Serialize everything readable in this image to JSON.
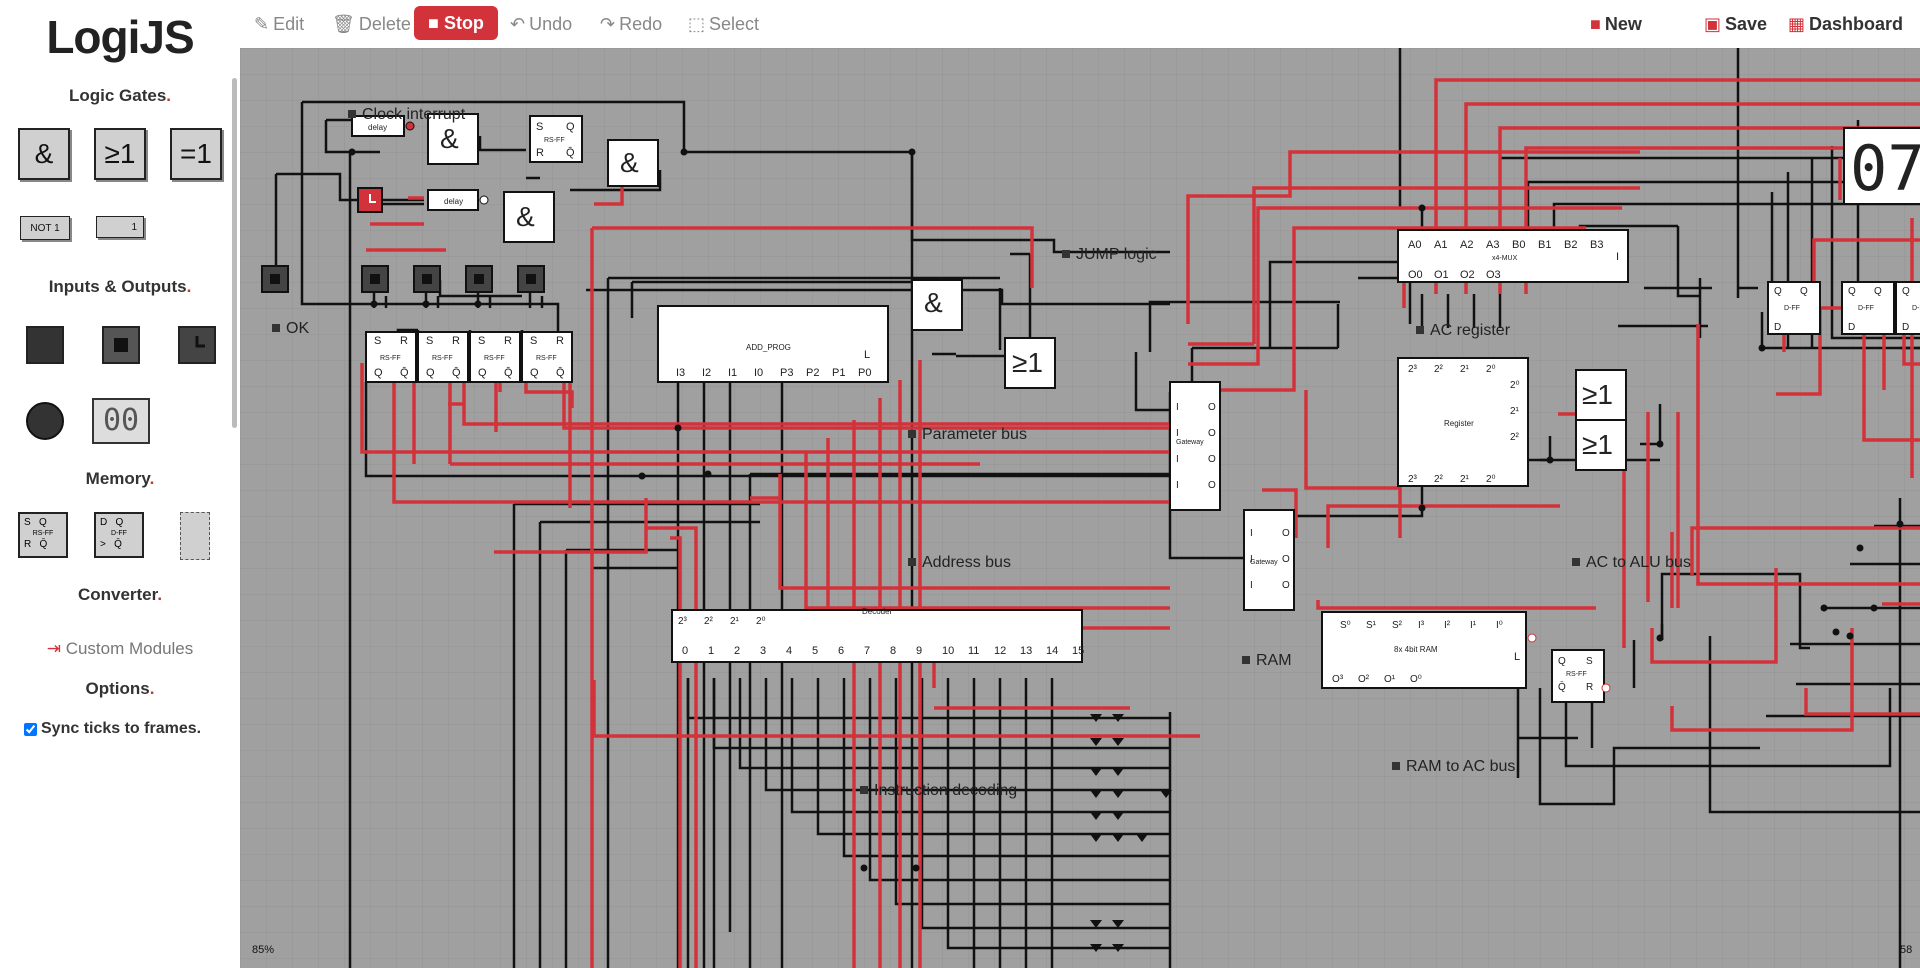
{
  "app": {
    "title": "LogiJS"
  },
  "sidebar": {
    "sections": {
      "logic_gates": "Logic Gates",
      "inputs_outputs": "Inputs & Outputs",
      "memory": "Memory",
      "converter": "Converter",
      "custom_modules": "Custom Modules",
      "options": "Options"
    },
    "gates": [
      {
        "label": "&"
      },
      {
        "label": "≥1"
      },
      {
        "label": "=1"
      }
    ],
    "unary": [
      {
        "label": "NOT 1"
      },
      {
        "label": "1"
      }
    ],
    "io_display": "00",
    "memory": [
      {
        "top": "S   Q",
        "mid": "RS-FF",
        "bot": "R   Q̄"
      },
      {
        "top": "D   Q",
        "mid": "D-FF",
        "bot": ">   Q̄"
      }
    ],
    "sync_ticks": {
      "label": "Sync ticks to frames.",
      "checked": true
    }
  },
  "toolbar": {
    "edit": "Edit",
    "delete": "Delete",
    "stop": "Stop",
    "undo": "Undo",
    "redo": "Redo",
    "select": "Select",
    "new": "New",
    "save": "Save",
    "dashboard": "Dashboard"
  },
  "canvas": {
    "labels": {
      "clock_interrupt": "Clock interrupt",
      "ok": "OK",
      "jump_logic": "JUMP logic",
      "parameter_bus": "Parameter bus",
      "address_bus": "Address bus",
      "instruction_decoding": "Instruction decoding",
      "ram": "RAM",
      "ac_register": "AC register",
      "ac_to_alu_bus": "AC to ALU bus",
      "ram_to_ac_bus": "RAM to AC bus"
    },
    "gates": {
      "and": "&",
      "or": "≥1",
      "delay": "delay"
    },
    "components": {
      "add_prog": {
        "name": "ADD_PROG",
        "pins": [
          "I3",
          "I2",
          "I1",
          "I0",
          "P3",
          "P2",
          "P1",
          "P0"
        ],
        "load": "L"
      },
      "decoder": {
        "name": "Decoder",
        "inputs": [
          "2³",
          "2²",
          "2¹",
          "2⁰"
        ],
        "outputs": [
          "0",
          "1",
          "2",
          "3",
          "4",
          "5",
          "6",
          "7",
          "8",
          "9",
          "10",
          "11",
          "12",
          "13",
          "14",
          "15"
        ]
      },
      "mux": {
        "name": "x4-MUX",
        "inputs": [
          "A0",
          "A1",
          "A2",
          "A3",
          "B0",
          "B1",
          "B2",
          "B3"
        ],
        "outputs": [
          "O0",
          "O1",
          "O2",
          "O3"
        ],
        "sel": "I"
      },
      "register": {
        "name": "Register",
        "pins_top": [
          "2³",
          "2²",
          "2¹",
          "2⁰"
        ],
        "pins_right": [
          "2⁰",
          "2¹",
          "2²"
        ],
        "pins_bot": [
          "2³",
          "2²",
          "2¹",
          "2⁰"
        ]
      },
      "ram": {
        "name": "8x 4bit RAM",
        "pins_top": [
          "S⁰",
          "S¹",
          "S²",
          "I³",
          "I²",
          "I¹",
          "I⁰"
        ],
        "pins_bot": [
          "O³",
          "O²",
          "O¹",
          "O⁰"
        ],
        "load": "L"
      },
      "gateway": {
        "name": "Gateway",
        "in": "I",
        "out": "O"
      },
      "rsff": {
        "name": "RS-FF",
        "s": "S",
        "r": "R",
        "q": "Q",
        "qn": "Q̄"
      },
      "dff": {
        "name": "D-FF",
        "d": "D",
        "q": "Q",
        "qn": "Q̄"
      },
      "display": "07"
    },
    "zoom_label": "85%",
    "fps_label": "58"
  },
  "colors": {
    "wire_active": "#d2323a",
    "wire_idle": "#111111",
    "canvas_bg": "#a0a0a0",
    "grid": "#939393",
    "accent": "#d2323a"
  }
}
